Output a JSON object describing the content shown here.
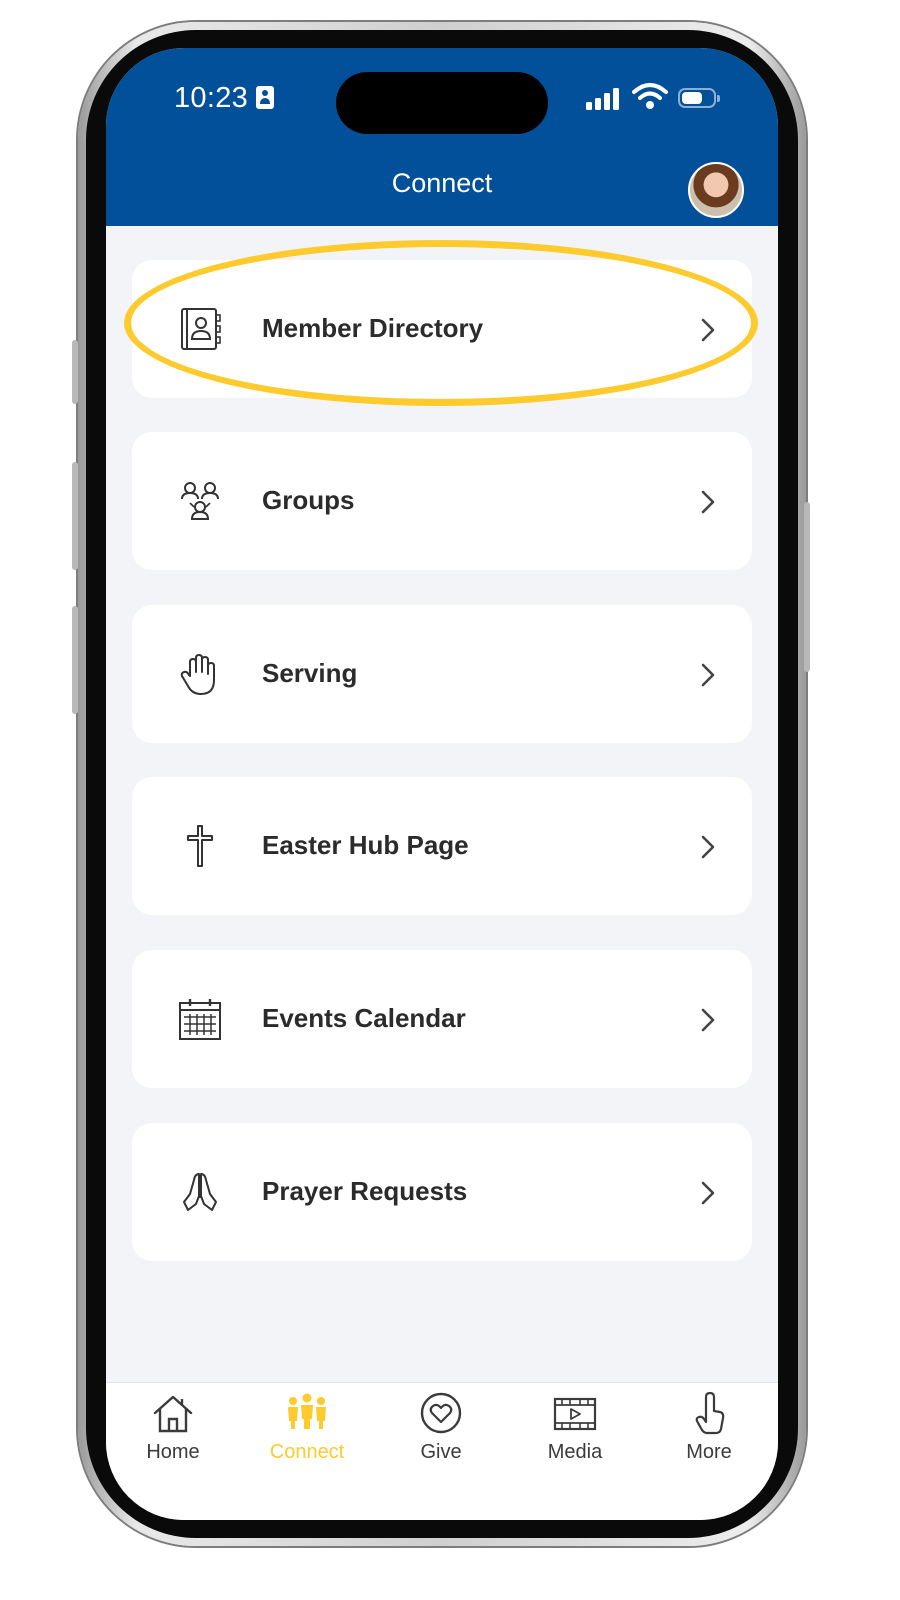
{
  "status_bar": {
    "time": "10:23",
    "icons": [
      "id-card-icon",
      "cellular-signal-icon",
      "wifi-icon",
      "battery-icon"
    ]
  },
  "header": {
    "title": "Connect",
    "background_color": "#02509a",
    "avatar": "profile-avatar"
  },
  "menu": {
    "items": [
      {
        "label": "Member Directory",
        "icon": "address-book-icon",
        "highlighted": true
      },
      {
        "label": "Groups",
        "icon": "people-group-icon",
        "highlighted": false
      },
      {
        "label": "Serving",
        "icon": "raised-hand-icon",
        "highlighted": false
      },
      {
        "label": "Easter Hub Page",
        "icon": "cross-icon",
        "highlighted": false
      },
      {
        "label": "Events Calendar",
        "icon": "calendar-icon",
        "highlighted": false
      },
      {
        "label": "Prayer Requests",
        "icon": "praying-hands-icon",
        "highlighted": false
      }
    ],
    "highlight_color": "#fdcb2e"
  },
  "tab_bar": {
    "active_color": "#fdcb2e",
    "tabs": [
      {
        "label": "Home",
        "icon": "house-icon",
        "active": false
      },
      {
        "label": "Connect",
        "icon": "people-icon",
        "active": true
      },
      {
        "label": "Give",
        "icon": "heart-circle-icon",
        "active": false
      },
      {
        "label": "Media",
        "icon": "film-play-icon",
        "active": false
      },
      {
        "label": "More",
        "icon": "pointing-hand-icon",
        "active": false
      }
    ]
  }
}
